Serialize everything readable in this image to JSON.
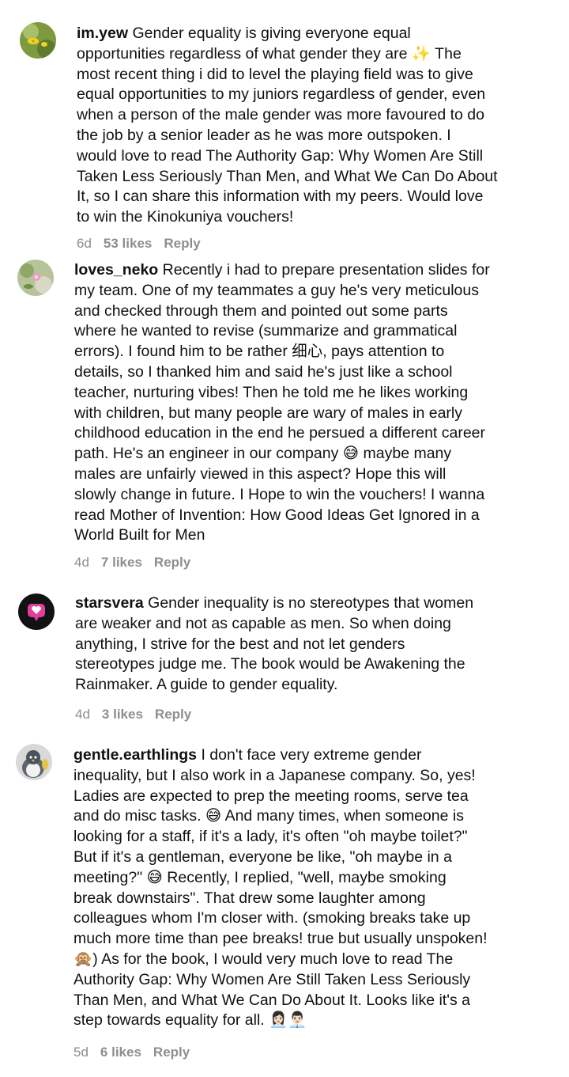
{
  "comments": [
    {
      "username": "im.yew",
      "text": " Gender equality is giving everyone equal\nopportunities regardless of what gender they are ✨ The\nmost recent thing i did to level the playing field was to give\nequal opportunities to my juniors regardless of gender, even\nwhen a person of the male gender was more favoured to do\nthe job by a senior leader as he was more outspoken. I\nwould love to read The Authority Gap: Why Women Are Still\nTaken Less Seriously Than Men, and What We Can Do About\nIt, so I can share this information with my peers. Would love\nto win the Kinokuniya vouchers!",
      "age": "6d",
      "likes": "53 likes",
      "reply": "Reply"
    },
    {
      "username": "loves_neko",
      "text": " Recently i had to prepare presentation slides for\nmy team. One of my teammates a guy he's very meticulous\nand checked through them and pointed out some parts\nwhere he wanted to revise (summarize and grammatical\nerrors). I found him to be rather 细心, pays attention to\ndetails, so I thanked him and said he's just like a school\nteacher, nurturing vibes! Then he told me he likes working\nwith children, but many people are wary of males in early\nchildhood education in the end he persued a different career\npath. He's an engineer in our company 😅 maybe many\nmales are unfairly viewed in this aspect? Hope this will\nslowly change in future. I Hope to win the vouchers! I wanna\nread Mother of Invention: How Good Ideas Get Ignored in a\nWorld Built for Men",
      "age": "4d",
      "likes": "7 likes",
      "reply": "Reply"
    },
    {
      "username": "starsvera",
      "text": " Gender inequality is no stereotypes that women\nare weaker and not as capable as men. So when doing\nanything, I strive for the best and not let genders\nstereotypes judge me. The book would be Awakening the\nRainmaker. A guide to gender equality.",
      "age": "4d",
      "likes": "3 likes",
      "reply": "Reply"
    },
    {
      "username": "gentle.earthlings",
      "text": " I don't face very extreme gender\ninequality, but I also work in a Japanese company. So, yes!\nLadies are expected to prep the meeting rooms, serve tea\nand do misc tasks. 😅 And many times, when someone is\nlooking for a staff, if it's a lady, it's often \"oh maybe toilet?\"\nBut if it's a gentleman, everyone be like, \"oh maybe in a\nmeeting?\" 😅 Recently, I replied, \"well, maybe smoking\nbreak downstairs\". That drew some laughter among\ncolleagues whom I'm closer with. (smoking breaks take up\nmuch more time than pee breaks! true but usually unspoken!\n🙊) As for the book, I would very much love to read The\nAuthority Gap: Why Women Are Still Taken Less Seriously\nThan Men, and What We Can Do About It. Looks like it's a\nstep towards equality for all. 👩🏻‍💼👨🏻‍💼",
      "age": "5d",
      "likes": "6 likes",
      "reply": "Reply"
    }
  ]
}
